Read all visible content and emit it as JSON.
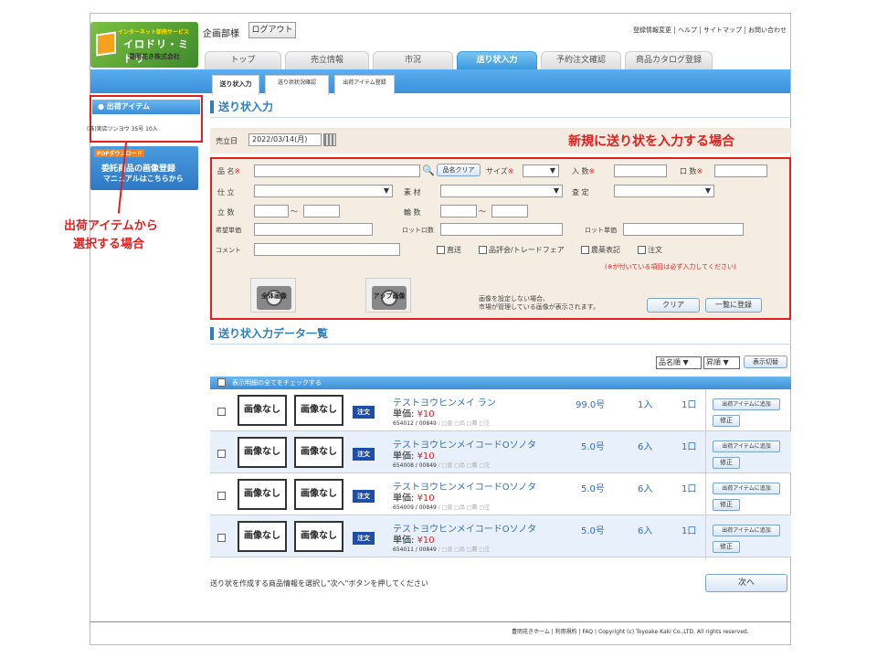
{
  "header": {
    "logo_line1": "インターネット卸売サービス",
    "logo_line2": "イロドリ・ミドリ",
    "logo_line3": "豊明花き株式会社",
    "dept": "企画部様",
    "logout_label": "ログアウト",
    "links": [
      "登録情報変更",
      "ヘルプ",
      "サイトマップ",
      "お問い合わせ"
    ]
  },
  "tabs": [
    "トップ",
    "売立情報",
    "市況",
    "送り状入力",
    "予約注文確認",
    "商品カタログ登録"
  ],
  "active_tab": "送り状入力",
  "subtabs": [
    "送り状入力",
    "送り状状況確認",
    "出荷アイテム登録"
  ],
  "sidebar": {
    "head": "出荷アイテム",
    "item": "(株)実店ツンヨウ 35号 10入",
    "pdf_label": "PDFダウンロード",
    "pdf_line1": "委託商品の画像登録",
    "pdf_line2": "マニュアルはこちらから"
  },
  "annotations": {
    "left_caption_1": "出荷アイテムから",
    "left_caption_2": "選択する場合",
    "right_caption": "新規に送り状を入力する場合"
  },
  "form_section": {
    "title": "送り状入力",
    "date_label": "売立日",
    "date_value": "2022/03/14(月)",
    "labels": {
      "name": "品 名",
      "name_clear": "品名クリア",
      "size": "サイズ",
      "irisu": "入 数",
      "kuchisu": "口 数",
      "shitate": "仕 立",
      "sozai": "素 材",
      "satei": "査 定",
      "rissu": "立 数",
      "rinsu": "輪 数",
      "kibo": "希望単価",
      "lot_kuchi": "ロット口数",
      "lot_tanka": "ロット単価",
      "comment": "コメント",
      "tilde": "～"
    },
    "checkboxes": [
      "直送",
      "品評会/トレードフェア",
      "農薬表記",
      "注文"
    ],
    "required_note": "(※が付いている項目は必ず入力してください)",
    "camera_whole": "全体画像",
    "camera_up": "アップ画像",
    "image_note_1": "画像を設定しない場合、",
    "image_note_2": "市場が管理している画像が表示されます。",
    "clear_button": "クリア",
    "register_button": "一覧に登録",
    "required_mark": "※"
  },
  "list_section": {
    "title": "送り状入力データ一覧",
    "sort_field": "品名順",
    "sort_order": "昇順",
    "sort_button": "表示切替",
    "check_all": "表示明細の全てをチェックする",
    "no_image": "画像なし",
    "order_badge": "注文",
    "price_label": "単価:",
    "add_button": "出荷アイテムに追加",
    "fix_button": "修正",
    "flags": "/ □直 □品 □農 □注",
    "rows": [
      {
        "name": "テストヨウヒンメイ ラン",
        "price": "¥10",
        "code": "654012 / 00849",
        "size": "99.0号",
        "irisu": "1入",
        "kuchi": "1口"
      },
      {
        "name": "テストヨウヒンメイコードOソノタ",
        "price": "¥10",
        "code": "654008 / 00849",
        "size": "5.0号",
        "irisu": "6入",
        "kuchi": "1口"
      },
      {
        "name": "テストヨウヒンメイコードOソノタ",
        "price": "¥10",
        "code": "654009 / 00849",
        "size": "5.0号",
        "irisu": "6入",
        "kuchi": "1口"
      },
      {
        "name": "テストヨウヒンメイコードOソノタ",
        "price": "¥10",
        "code": "654011 / 00849",
        "size": "5.0号",
        "irisu": "6入",
        "kuchi": "1口"
      }
    ],
    "instruction": "送り状を作成する商品情報を選択し\"次へ\"ボタンを押してください",
    "next_button": "次へ"
  },
  "footer": {
    "text": "豊明花きホーム | 利用規約 | FAQ | Copyright (c) Toyoake Kaki Co.,LTD. All rights reserved."
  },
  "colors": {
    "accent_blue": "#3a8fd8",
    "annotation_red": "#e02020",
    "form_bg": "#f5ede2"
  }
}
